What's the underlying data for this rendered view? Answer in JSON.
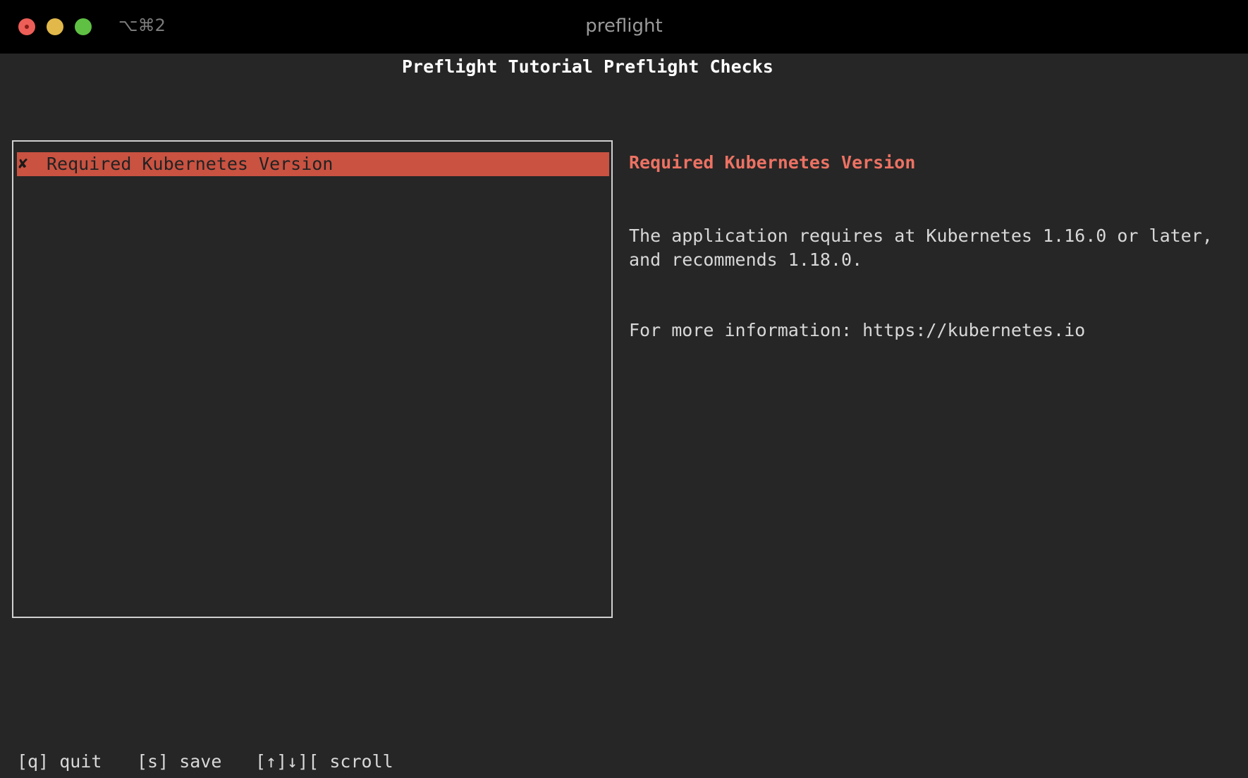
{
  "titlebar": {
    "shortcut": "⌥⌘2",
    "title": "preflight"
  },
  "header": {
    "title": "Preflight Tutorial Preflight Checks"
  },
  "checks": {
    "items": [
      {
        "mark": "✘",
        "label": "Required Kubernetes Version",
        "status": "fail"
      }
    ]
  },
  "detail": {
    "title": "Required Kubernetes Version",
    "description": "The application requires at Kubernetes 1.16.0 or later, and recommends 1.18.0.",
    "more_info": "For more information: https://kubernetes.io"
  },
  "footer": {
    "quit": "[q] quit",
    "save": "[s] save",
    "scroll": "[↑]↓][ scroll"
  },
  "colors": {
    "background": "#262626",
    "titlebar": "#000000",
    "fail_highlight": "#c95241",
    "fail_text": "#ec7263"
  }
}
